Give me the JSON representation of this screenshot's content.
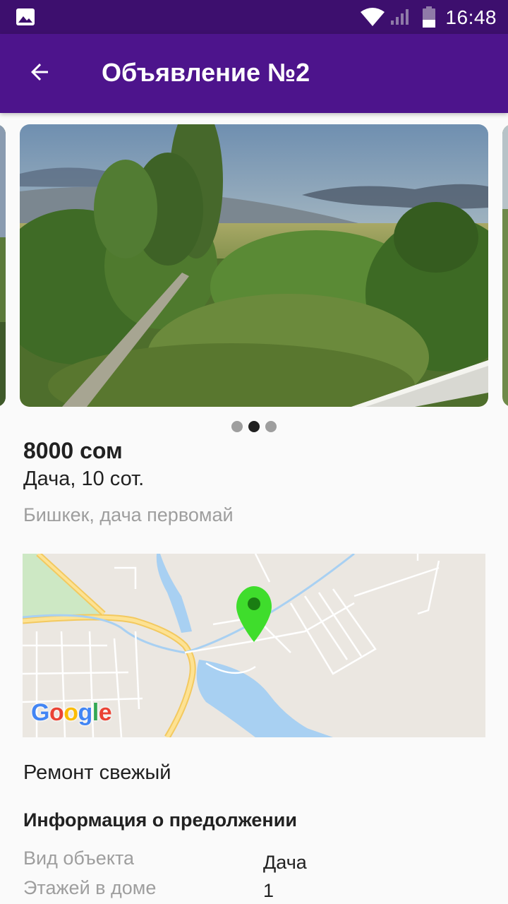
{
  "status_bar": {
    "time": "16:48",
    "icons": [
      "gallery-icon",
      "wifi-icon",
      "signal-icon",
      "battery-icon"
    ]
  },
  "app_bar": {
    "title": "Объявление №2",
    "back_icon": "arrow-back-icon"
  },
  "carousel": {
    "slide_count": 3,
    "active_index": 1
  },
  "listing": {
    "price": "8000 сом",
    "subtitle": "Дача, 10 сот.",
    "address": "Бишкек, дача первомай",
    "renovation": "Ремонт свежый"
  },
  "map": {
    "provider_logo": "Google",
    "pin_icon": "map-pin-icon"
  },
  "info": {
    "section_title": "Информация о предолжении",
    "rows": [
      {
        "label": "Вид объекта",
        "value": "Дача"
      },
      {
        "label": "Этажей в доме",
        "value": "1"
      }
    ]
  },
  "colors": {
    "status_bar": "#3d0f6e",
    "app_bar": "#4d148c",
    "pin": "#3fdd2c",
    "muted_text": "#9e9e9e"
  }
}
